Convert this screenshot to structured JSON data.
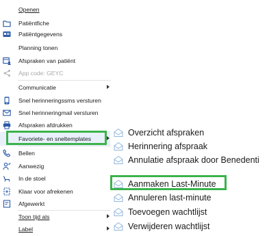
{
  "colors": {
    "highlight_border": "#3bb24a",
    "icon_blue": "#2b5aa8",
    "disabled_text": "#a8a8a8",
    "envelope": "#8fb6dc"
  },
  "menu": {
    "items": [
      {
        "label": "Openen",
        "icon": "none",
        "underline": true
      },
      {
        "label": "Patiëntfiche",
        "icon": "folder-icon"
      },
      {
        "label": "Patiëntgegevens",
        "icon": "id-card-icon"
      },
      {
        "label": "Planning tonen",
        "icon": "none"
      },
      {
        "label": "Afspraken van patiënt",
        "icon": "calendar-person-icon"
      },
      {
        "label": "App code: GEYC",
        "icon": "share-icon",
        "disabled": true
      },
      {
        "label": "Communicatie",
        "icon": "none",
        "submenu": true
      },
      {
        "label": "Snel herinneringssms versturen",
        "icon": "phone-icon"
      },
      {
        "label": "Snel herinneringmail versturen",
        "icon": "mail-icon"
      },
      {
        "label": "Afspraken afdrukken",
        "icon": "printer-icon"
      },
      {
        "label": "Favoriete- en sneltemplates",
        "icon": "none",
        "submenu": true
      },
      {
        "label": "Bellen",
        "icon": "call-icon"
      },
      {
        "label": "Aanwezig",
        "icon": "person-check-icon"
      },
      {
        "label": "In de stoel",
        "icon": "chair-icon"
      },
      {
        "label": "Klaar voor afrekenen",
        "icon": "checkout-icon"
      },
      {
        "label": "Afgewerkt",
        "icon": "done-icon"
      },
      {
        "label": "Toon tijd als",
        "icon": "none",
        "submenu": true
      },
      {
        "label": "Label",
        "icon": "none",
        "submenu": true
      }
    ]
  },
  "submenu": {
    "items": [
      {
        "label": "Overzicht afspraken"
      },
      {
        "label": "Herinnering afspraak"
      },
      {
        "label": "Annulatie afspraak door Benedenti"
      },
      {
        "label": "Aanmaken Last-Minute"
      },
      {
        "label": "Annuleren last-minute"
      },
      {
        "label": "Toevoegen wachtlijst"
      },
      {
        "label": "Verwijderen wachtlijst"
      }
    ]
  }
}
